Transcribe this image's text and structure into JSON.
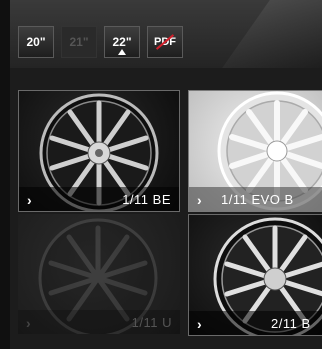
{
  "toolbar": {
    "sizes": [
      {
        "label": "20\"",
        "state": "enabled"
      },
      {
        "label": "21\"",
        "state": "disabled"
      },
      {
        "label": "22\"",
        "state": "selected"
      }
    ],
    "pdf_label": "PDF"
  },
  "tiles": [
    {
      "name": "1/11 BE",
      "style": "dark-chrome"
    },
    {
      "name": "1/11 EVO B",
      "style": "silver"
    },
    {
      "name": "1/11 U",
      "style": "faded"
    },
    {
      "name": "2/11 B",
      "style": "dark-chrome"
    }
  ],
  "colors": {
    "background": "#1c1c1c",
    "pdf_accent": "#d0202b"
  }
}
